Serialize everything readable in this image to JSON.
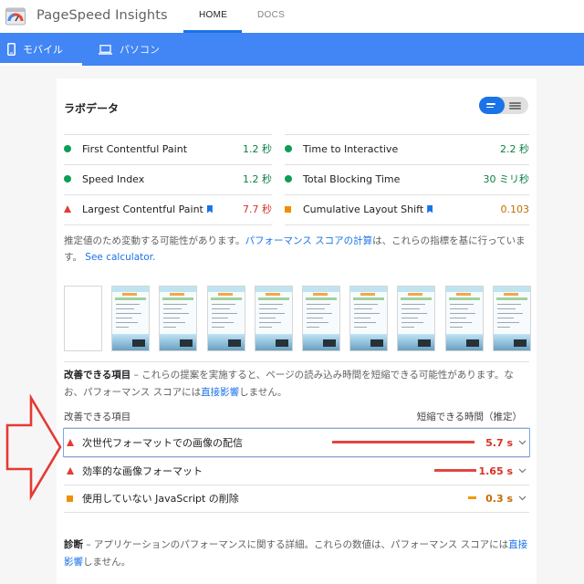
{
  "header": {
    "app_title": "PageSpeed Insights",
    "nav": [
      "HOME",
      "DOCS"
    ],
    "active_nav": "HOME"
  },
  "devices": [
    {
      "label": "モバイル",
      "icon": "smartphone-icon",
      "active": true
    },
    {
      "label": "パソコン",
      "icon": "laptop-icon",
      "active": false
    }
  ],
  "lab": {
    "title": "ラボデータ",
    "metrics_left": [
      {
        "label": "First Contentful Paint",
        "value": "1.2 秒",
        "status": "pass",
        "bookmark": false
      },
      {
        "label": "Speed Index",
        "value": "1.2 秒",
        "status": "pass",
        "bookmark": false
      },
      {
        "label": "Largest Contentful Paint",
        "value": "7.7 秒",
        "status": "fail",
        "bookmark": true
      }
    ],
    "metrics_right": [
      {
        "label": "Time to Interactive",
        "value": "2.2 秒",
        "status": "pass",
        "bookmark": false
      },
      {
        "label": "Total Blocking Time",
        "value": "30 ミリ秒",
        "status": "pass",
        "bookmark": false
      },
      {
        "label": "Cumulative Layout Shift",
        "value": "0.103",
        "status": "average",
        "bookmark": true
      }
    ],
    "note_text": "推定値のため変動する可能性があります。",
    "note_link1": "パフォーマンス スコアの計算",
    "note_mid": "は、これらの指標を基に行っています。",
    "note_link2": "See calculator."
  },
  "filmstrip": {
    "frames": 10
  },
  "opportunities": {
    "title": "改善できる項目",
    "desc": " – これらの提案を実施すると、ページの読み込み時間を短縮できる可能性があります。なお、パフォーマンス スコアには",
    "desc_link": "直接影響",
    "desc_end": "しません。",
    "col_item": "改善できる項目",
    "col_savings": "短縮できる時間（推定）",
    "items": [
      {
        "label": "次世代フォーマットでの画像の配信",
        "value": "5.7 s",
        "status": "fail",
        "savings_fraction": 1.0
      },
      {
        "label": "効率的な画像フォーマット",
        "value": "1.65 s",
        "status": "fail",
        "savings_fraction": 0.29
      },
      {
        "label": "使用していない JavaScript の削除",
        "value": "0.3 s",
        "status": "average",
        "savings_fraction": 0.05
      }
    ]
  },
  "diagnostics": {
    "title": "診断",
    "desc": " – アプリケーションのパフォーマンスに関する詳細。これらの数値は、パフォーマンス スコアには",
    "desc_link": "直接影響",
    "desc_end": "しません。"
  },
  "colors": {
    "accent": "#4285f4",
    "pass": "#0c9d57",
    "fail": "#e53935",
    "average": "#ef8f00",
    "annotation": "#e53935"
  }
}
